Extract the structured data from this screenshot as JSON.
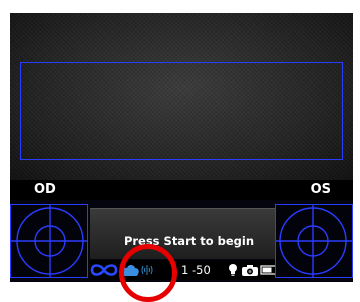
{
  "eyes": {
    "left": "OD",
    "right": "OS"
  },
  "message": "Press Start to begin",
  "status": {
    "time": "1 -50",
    "icons": [
      "infinity-icon",
      "cloud-icon",
      "signal-icon",
      "bulb-icon",
      "camera-icon",
      "battery-icon"
    ]
  },
  "colors": {
    "accent_blue": "#2a3cff",
    "cloud_blue": "#3a8fe0",
    "highlight_red": "#e60000"
  }
}
